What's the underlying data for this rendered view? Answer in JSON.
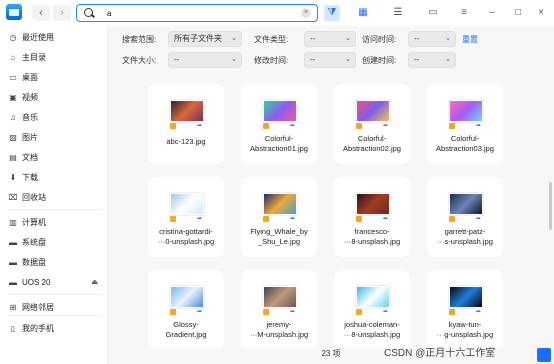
{
  "toolbar": {
    "search_value": "a",
    "clear_symbol": "×",
    "back_symbol": "‹",
    "forward_symbol": "›",
    "filter_symbol": "⧩",
    "icon_view_symbol": "▦",
    "list_view_symbol": "☰",
    "detail_symbol": "▭",
    "menu_symbol": "≡",
    "min_symbol": "–",
    "max_symbol": "□",
    "close_symbol": "×"
  },
  "sidebar": {
    "items": [
      {
        "label": "最近使用",
        "icon": "clock-icon",
        "glyph": "◷"
      },
      {
        "label": "主目录",
        "icon": "home-icon",
        "glyph": "⌂"
      },
      {
        "label": "桌面",
        "icon": "desktop-icon",
        "glyph": "▭"
      },
      {
        "label": "视频",
        "icon": "video-icon",
        "glyph": "▣"
      },
      {
        "label": "音乐",
        "icon": "music-icon",
        "glyph": "♫"
      },
      {
        "label": "图片",
        "icon": "picture-icon",
        "glyph": "▨"
      },
      {
        "label": "文档",
        "icon": "document-icon",
        "glyph": "▤"
      },
      {
        "label": "下载",
        "icon": "download-icon",
        "glyph": "⬇"
      },
      {
        "label": "回收站",
        "icon": "trash-icon",
        "glyph": "⌧"
      },
      {
        "label": "计算机",
        "icon": "computer-icon",
        "glyph": "▥"
      },
      {
        "label": "系统盘",
        "icon": "disk-icon",
        "glyph": "▬"
      },
      {
        "label": "数据盘",
        "icon": "disk-icon",
        "glyph": "▬"
      },
      {
        "label": "UOS 20",
        "icon": "disk-icon",
        "glyph": "▬"
      },
      {
        "label": "网络邻居",
        "icon": "network-icon",
        "glyph": "⊞"
      },
      {
        "label": "我的手机",
        "icon": "phone-icon",
        "glyph": "▯"
      }
    ],
    "eject_symbol": "⏏"
  },
  "filters": {
    "scope_label": "搜索范围:",
    "scope_value": "所有子文件夹",
    "type_label": "文件类型:",
    "type_value": "--",
    "access_label": "访问时间:",
    "access_value": "--",
    "reset_label": "重置",
    "size_label": "文件大小:",
    "size_value": "--",
    "modify_label": "修改时间:",
    "modify_value": "--",
    "create_label": "创建时间:",
    "create_value": "--",
    "chevron": "⌄"
  },
  "files": [
    {
      "name": "abc-123.jpg",
      "colors": [
        "#2b2230",
        "#d86a3b",
        "#7a2f5e"
      ]
    },
    {
      "name": "Colorful-\nAbstraction01.jpg",
      "colors": [
        "#35d39a",
        "#8a5cf0",
        "#f05a9a"
      ]
    },
    {
      "name": "Colorful-\nAbstraction02.jpg",
      "colors": [
        "#f04f7a",
        "#7c5cf0",
        "#f7c54a"
      ]
    },
    {
      "name": "Colorful-\nAbstraction03.jpg",
      "colors": [
        "#ff6ac1",
        "#a55cf0",
        "#6fd3ff"
      ]
    },
    {
      "name": "cristina-gottardi-\n···0-unsplash.jpg",
      "colors": [
        "#9ec6e8",
        "#ffffff",
        "#d5e8f5"
      ]
    },
    {
      "name": "Flying_Whale_by\n_Shu_Le.jpg",
      "colors": [
        "#1e2a6a",
        "#f0a83a",
        "#3fa0c8"
      ]
    },
    {
      "name": "francesco-\n···8-unsplash.jpg",
      "colors": [
        "#2c1414",
        "#a33b25",
        "#6a2a1e"
      ]
    },
    {
      "name": "garrett-patz-\n···s-unsplash.jpg",
      "colors": [
        "#1d2a4e",
        "#6d84b8",
        "#0d1530"
      ]
    },
    {
      "name": "Glossy-\nGradient.jpg",
      "colors": [
        "#7cb8f0",
        "#e8f2ff",
        "#4b8be0"
      ]
    },
    {
      "name": "jeremy-\n···M-unsplash.jpg",
      "colors": [
        "#3c4450",
        "#c29a7a",
        "#6b5a58"
      ]
    },
    {
      "name": "joshua-coleman-\n···8-unsplash.jpg",
      "colors": [
        "#35b8e8",
        "#ffffff",
        "#67d0f0"
      ]
    },
    {
      "name": "kyaw-tun-\n···g-unsplash.jpg",
      "colors": [
        "#05060a",
        "#1e7fe0",
        "#05060a"
      ]
    }
  ],
  "status": {
    "count": "23 项"
  },
  "watermark": "CSDN @正月十六工作室"
}
